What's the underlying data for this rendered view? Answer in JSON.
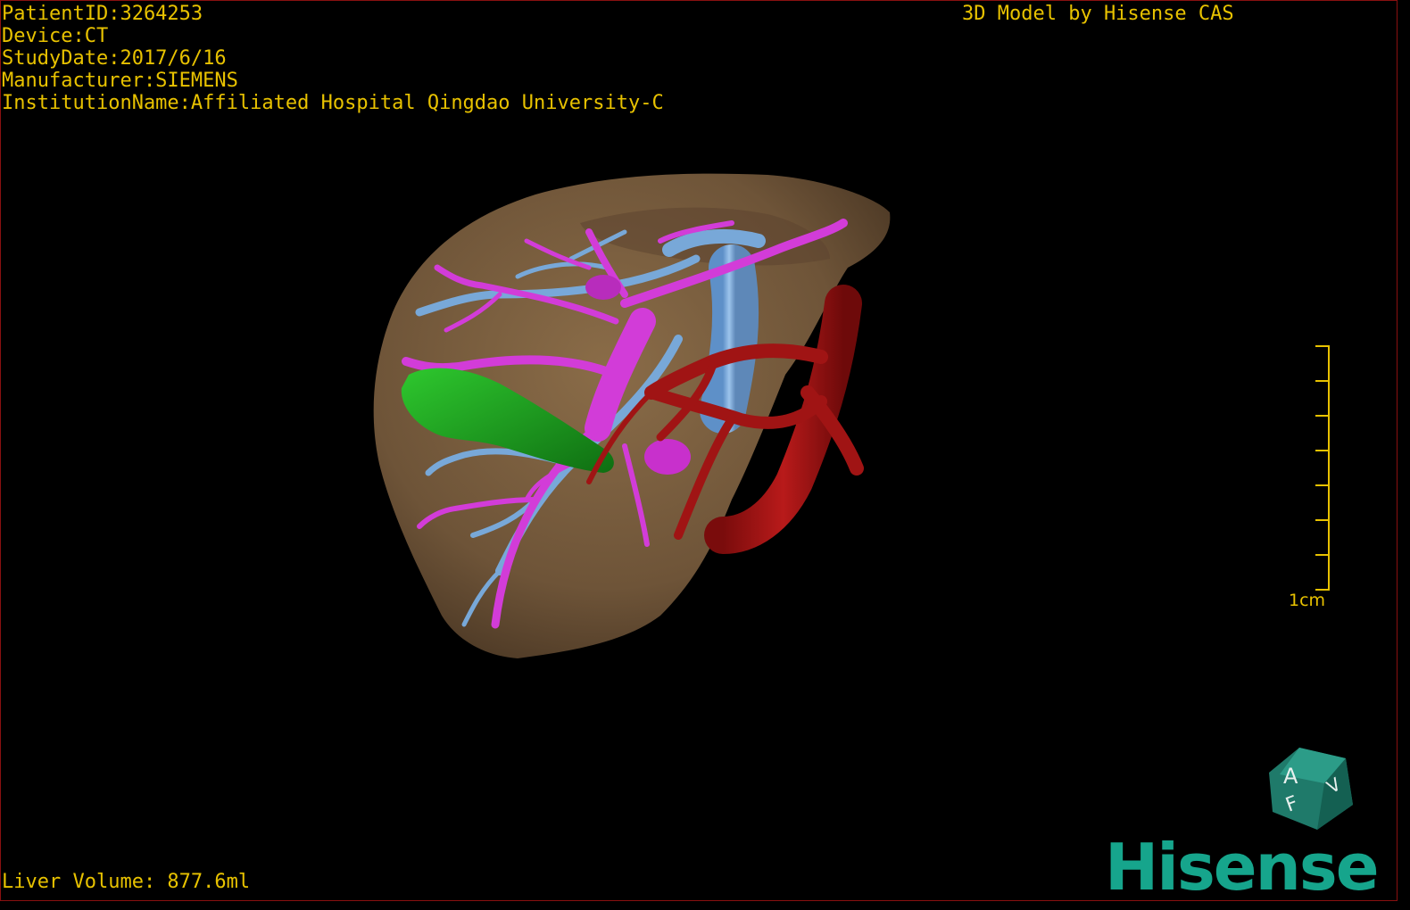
{
  "header": {
    "patient_id": "PatientID:3264253",
    "device": "Device:CT",
    "study_date": "StudyDate:2017/6/16",
    "manufacturer": "Manufacturer:SIEMENS",
    "institution": "InstitutionName:Affiliated Hospital Qingdao University-C"
  },
  "credit": "3D Model by Hisense CAS",
  "footer": {
    "liver_volume": "Liver Volume: 877.6ml"
  },
  "scale": {
    "label": "1cm"
  },
  "orientation_cube": {
    "faces": [
      "A",
      "F",
      "V"
    ]
  },
  "brand": "Hisense",
  "colors": {
    "text": "#e8c200",
    "liver": "#7a6040",
    "portal_vein": "#d23cd8",
    "hepatic_vein": "#78a8d8",
    "gallbladder": "#1e9a1e",
    "artery": "#a01414",
    "brand": "#16a58c"
  },
  "model": {
    "structures": [
      "liver-surface",
      "portal-vein",
      "hepatic-vein",
      "gallbladder",
      "hepatic-artery-aorta"
    ]
  }
}
